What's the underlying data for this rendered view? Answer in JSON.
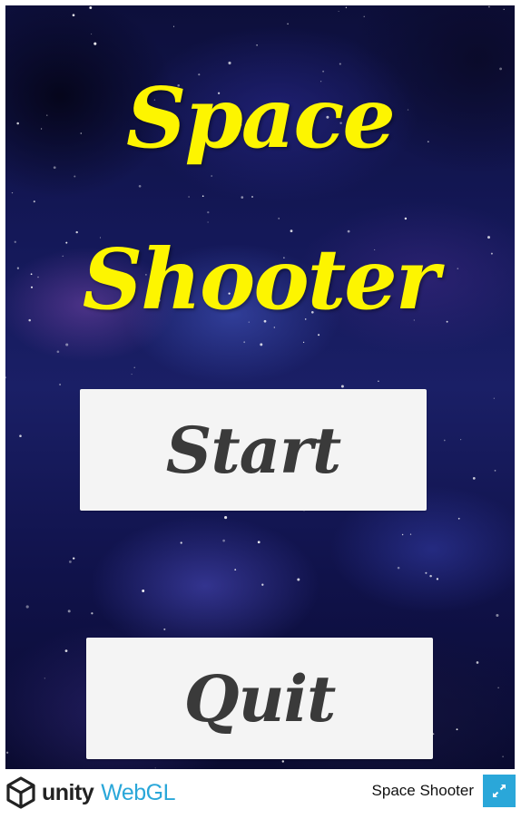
{
  "game": {
    "title_line_1": "Space",
    "title_line_2": "Shooter",
    "start_label": "Start",
    "quit_label": "Quit"
  },
  "footer": {
    "unity_label": "unity",
    "webgl_label": "WebGL",
    "game_title": "Space Shooter",
    "fullscreen_icon": "fullscreen-icon"
  },
  "colors": {
    "title": "#fdf500",
    "button_bg": "#f4f4f4",
    "button_text": "#3a3a3a",
    "webgl_accent": "#2aa7d9",
    "fullscreen_bg": "#2aa7d9"
  }
}
